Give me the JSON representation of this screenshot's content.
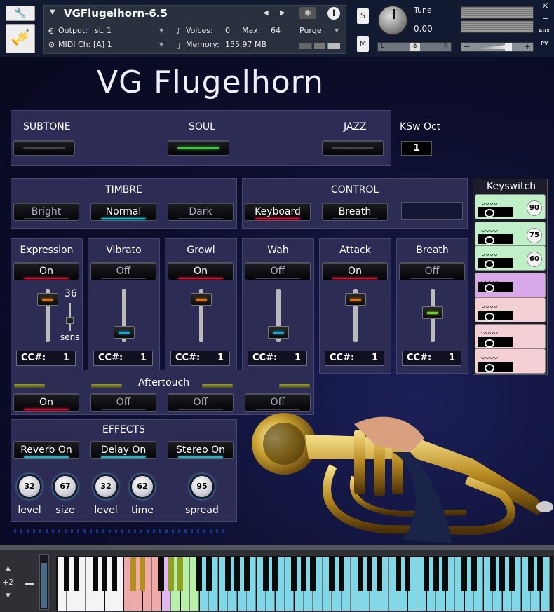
{
  "header": {
    "instrument_name": "VGFlugelhorn-6.5",
    "output_label": "Output:",
    "output_value": "st. 1",
    "voices_label": "Voices:",
    "voices_value": "0",
    "max_label": "Max:",
    "max_value": "64",
    "purge_label": "Purge",
    "midi_label": "MIDI Ch:",
    "midi_value": "[A]  1",
    "memory_label": "Memory:",
    "memory_value": "155.97 MB",
    "tune_label": "Tune",
    "tune_value": "0.00",
    "solo_label": "S",
    "mute_label": "M",
    "pan_left": "L",
    "pan_right": "R",
    "aux_label": "AUX",
    "pv_label": "PV",
    "close_symbol": "×",
    "minimize_symbol": "−",
    "vol_minus": "−",
    "vol_plus": "+"
  },
  "title": "VG Flugelhorn",
  "articulation": {
    "subtone": "SUBTONE",
    "soul": "SOUL",
    "jazz": "JAZZ",
    "ksw_label": "KSw Oct",
    "ksw_value": "1"
  },
  "timbre": {
    "title": "TIMBRE",
    "bright": "Bright",
    "normal": "Normal",
    "dark": "Dark"
  },
  "control": {
    "title": "CONTROL",
    "keyboard": "Keyboard",
    "breath": "Breath"
  },
  "channels": [
    {
      "name": "Expression",
      "state": "On",
      "cc_label": "CC#:",
      "cc": "1",
      "level": 0.85
    },
    {
      "name": "Vibrato",
      "state": "Off",
      "cc_label": "CC#:",
      "cc": "1",
      "level": 0.1
    },
    {
      "name": "Growl",
      "state": "On",
      "cc_label": "CC#:",
      "cc": "1",
      "level": 0.85
    },
    {
      "name": "Wah",
      "state": "Off",
      "cc_label": "CC#:",
      "cc": "1",
      "level": 0.1
    },
    {
      "name": "Attack",
      "state": "On",
      "cc_label": "CC#:",
      "cc": "1",
      "level": 0.85
    },
    {
      "name": "Breath",
      "state": "Off",
      "cc_label": "CC#:",
      "cc": "1",
      "level": 0.55
    }
  ],
  "sens": {
    "value": "36",
    "label": "sens"
  },
  "aftertouch": {
    "title": "Aftertouch",
    "states": [
      "On",
      "Off",
      "Off",
      "Off"
    ]
  },
  "effects": {
    "title": "EFFECTS",
    "reverb": "Reverb On",
    "delay": "Delay On",
    "stereo": "Stereo On",
    "knobs": [
      {
        "value": "32",
        "label": "level"
      },
      {
        "value": "67",
        "label": "size"
      },
      {
        "value": "32",
        "label": "level"
      },
      {
        "value": "62",
        "label": "time"
      },
      {
        "value": "95",
        "label": "spread"
      }
    ]
  },
  "keyswitch": {
    "title": "Keyswitch",
    "badges": [
      "90",
      "75",
      "60"
    ]
  },
  "keyboard": {
    "octave": "+2",
    "colors": {
      "red": "#f0a8a8",
      "green": "#b8f0a8",
      "purple": "#e0b8f0",
      "cyan": "#7fd8e8"
    }
  }
}
